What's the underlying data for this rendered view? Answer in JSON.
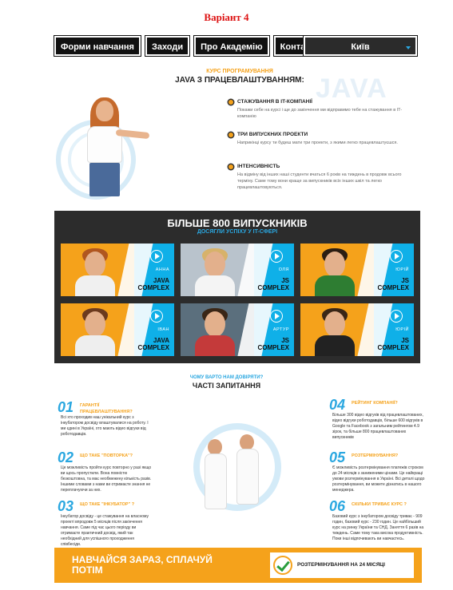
{
  "variant_title": "Варіант 4",
  "nav": {
    "items": [
      "Форми навчання",
      "Заходи",
      "Про Академію",
      "Контакти"
    ],
    "city": "Київ"
  },
  "course": {
    "subtitle": "КУРС ПРОГРАМУВАННЯ",
    "title": "JAVA З ПРАЦЕВЛАШТУВАННЯМ:",
    "bg_word": "JAVA",
    "features": [
      {
        "title": "СТАЖУВАННЯ В IT-КОМПАНІЇ",
        "text": "Покажи себе на курсі і ще до закінчення ми відправимо тебе на стажування в IT-компанію"
      },
      {
        "title": "ТРИ ВИПУСКНИХ ПРОЕКТИ",
        "text": "Наприкінці курсу ти будеш мати три проекти, з якими легко працевлаштуєшся."
      },
      {
        "title": "ІНТЕНСИВНІСТЬ",
        "text": "На відміну від інших наші студенти вчаться 6 років на тиждень в продовж всього терміну. Саме тому вони краще за випускників всіх інших шкіл та легко працевлаштовуються."
      }
    ]
  },
  "graduates": {
    "title": "БІЛЬШЕ 800 ВИПУСКНИКІВ",
    "subtitle": "ДОСЯГЛИ УСПІХУ У IT-СФЕРІ",
    "cards": [
      {
        "name": "АННА",
        "track": "JAVA COMPLEX"
      },
      {
        "name": "ОЛЯ",
        "track": "JS COMPLEX"
      },
      {
        "name": "ЮРІЙ",
        "track": "JS COMPLEX"
      },
      {
        "name": "ІВАН",
        "track": "JAVA COMPLEX"
      },
      {
        "name": "АРТУР",
        "track": "JS COMPLEX"
      },
      {
        "name": "ЮРІЙ",
        "track": "JS COMPLEX"
      }
    ]
  },
  "faq": {
    "subtitle": "ЧОМУ ВАРТО НАМ ДОВІРЯТИ?",
    "title": "ЧАСТІ ЗАПИТАННЯ",
    "items": [
      {
        "num": "01",
        "q": "ГАРАНТІЇ ПРАЦЕВЛАШТУВАННЯ?",
        "a": "Всі хто проходив наш унікальний курс з інкубатором досвіду влаштувалися на роботу. І ми єдині в Україні, хто мають відео відгуки від роботодавців."
      },
      {
        "num": "02",
        "q": "ЩО ТАКЕ \"ПОВТОРКА\"?",
        "a": "Це можливість пройти курс повторно у разі якщо ви щось пропустили. Вона повністю безкоштовна, та має необмежену кількість разів. Іншими словами з нами ви отримаєте знання не переплачуючи за них."
      },
      {
        "num": "03",
        "q": "ЩО ТАКЕ \"ІНКУБАТОР\" ?",
        "a": "Інкубатор досвіду - це стажування на власному проекті впродовж 5 місяців після закінчення навчання. Саме під час цього періоду ви отримаєте практичний досвід, який так необхідний для успішного проходження співбесіди."
      },
      {
        "num": "04",
        "q": "РЕЙТИНГ КОМПАНІЇ?",
        "a": "Більше 300 відео відгуків від працевлаштованих, відео відгуки роботодавців, більше 600 відгуків в Google та Facebook з загальним рейтингом 4.9 зірок, та більше 800 працевлаштованих випускників"
      },
      {
        "num": "05",
        "q": "РОЗТЕРМІНУВАННЯ?",
        "a": "Є можливість розтермінування платежів строком до 24 місяців з заниженими цінами. Це найкращі умови розтермінування в Україні. Всі деталі щодо розтермінування, ви можете дізнатись в нашого менеджера."
      },
      {
        "num": "06",
        "q": "СКІЛЬКИ ТРИВАЄ КУРС ?",
        "a": "Базовий курс з інкубатором досвіду триває - 909 годин, базовий курс - 230 годин. Це найбільший курс на ринку України та СНД. Заняття 6 разів на тиждень. Саме тому така висока продуктивність. Поки інші відпочивають ви навчаєтесь."
      }
    ]
  },
  "cta": {
    "left": "НАВЧАЙСЯ ЗАРАЗ, СПЛАЧУЙ ПОТІМ",
    "right": "РОЗТЕРМІНУВАННЯ НА 24 МІСЯЦІ"
  }
}
